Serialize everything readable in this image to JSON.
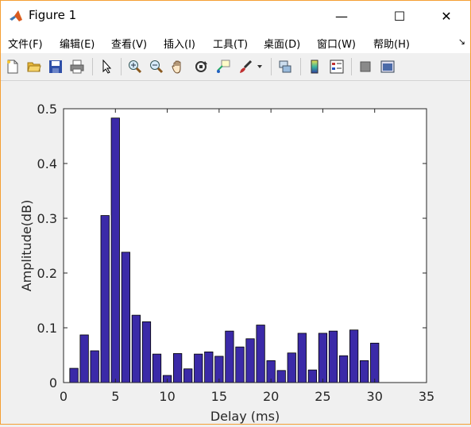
{
  "window": {
    "title": "Figure 1",
    "controls": {
      "minimize": "—",
      "maximize": "☐",
      "close": "✕"
    }
  },
  "menu": {
    "items": [
      {
        "label": "文件(F)"
      },
      {
        "label": "编辑(E)"
      },
      {
        "label": "查看(V)"
      },
      {
        "label": "插入(I)"
      },
      {
        "label": "工具(T)"
      },
      {
        "label": "桌面(D)"
      },
      {
        "label": "窗口(W)"
      },
      {
        "label": "帮助(H)"
      }
    ],
    "overflow": "↘"
  },
  "toolbar": {
    "buttons": [
      "new-figure-icon",
      "open-file-icon",
      "save-icon",
      "print-icon",
      "edit-plot-arrow-icon",
      "zoom-in-icon",
      "zoom-out-icon",
      "pan-hand-icon",
      "rotate-3d-icon",
      "data-cursor-icon",
      "brush-icon",
      "brush-dropdown-icon",
      "link-plot-icon",
      "insert-colorbar-icon",
      "insert-legend-icon",
      "hide-plot-tools-icon",
      "show-plot-tools-icon"
    ]
  },
  "colors": {
    "bar_fill": "#3b2aa8",
    "bar_edge": "#000000",
    "window_border": "#f59f33"
  },
  "chart_data": {
    "type": "bar",
    "xlabel": "Delay (ms)",
    "ylabel": "Amplitude(dB)",
    "xlim": [
      0,
      35
    ],
    "ylim": [
      0,
      0.5
    ],
    "xticks": [
      0,
      5,
      10,
      15,
      20,
      25,
      30,
      35
    ],
    "yticks": [
      0,
      0.1,
      0.2,
      0.3,
      0.4,
      0.5
    ],
    "grid": false,
    "x": [
      1,
      2,
      3,
      4,
      5,
      6,
      7,
      8,
      9,
      10,
      11,
      12,
      13,
      14,
      15,
      16,
      17,
      18,
      19,
      20,
      21,
      22,
      23,
      24,
      25,
      26,
      27,
      28,
      29,
      30
    ],
    "values": [
      0.026,
      0.087,
      0.058,
      0.305,
      0.483,
      0.238,
      0.123,
      0.111,
      0.052,
      0.013,
      0.053,
      0.025,
      0.052,
      0.056,
      0.048,
      0.094,
      0.065,
      0.08,
      0.105,
      0.04,
      0.022,
      0.054,
      0.09,
      0.023,
      0.09,
      0.094,
      0.049,
      0.096,
      0.04,
      0.072
    ]
  }
}
